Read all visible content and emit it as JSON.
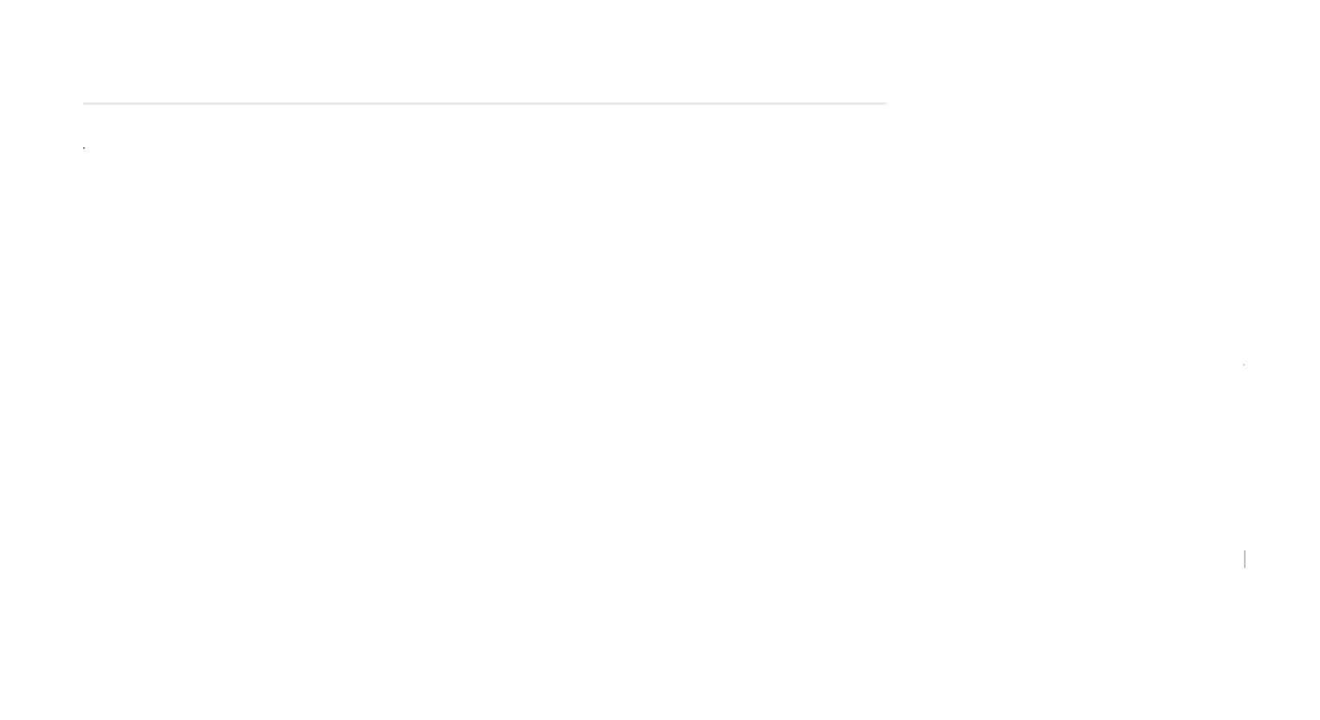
{
  "page": {
    "title": "",
    "sidebar_title": ""
  },
  "main": {
    "rows": []
  },
  "sidebar": {
    "links": []
  },
  "colors": {
    "background": "#ffffff",
    "rule": "#e9eaee",
    "marker": "#7a7d86"
  }
}
